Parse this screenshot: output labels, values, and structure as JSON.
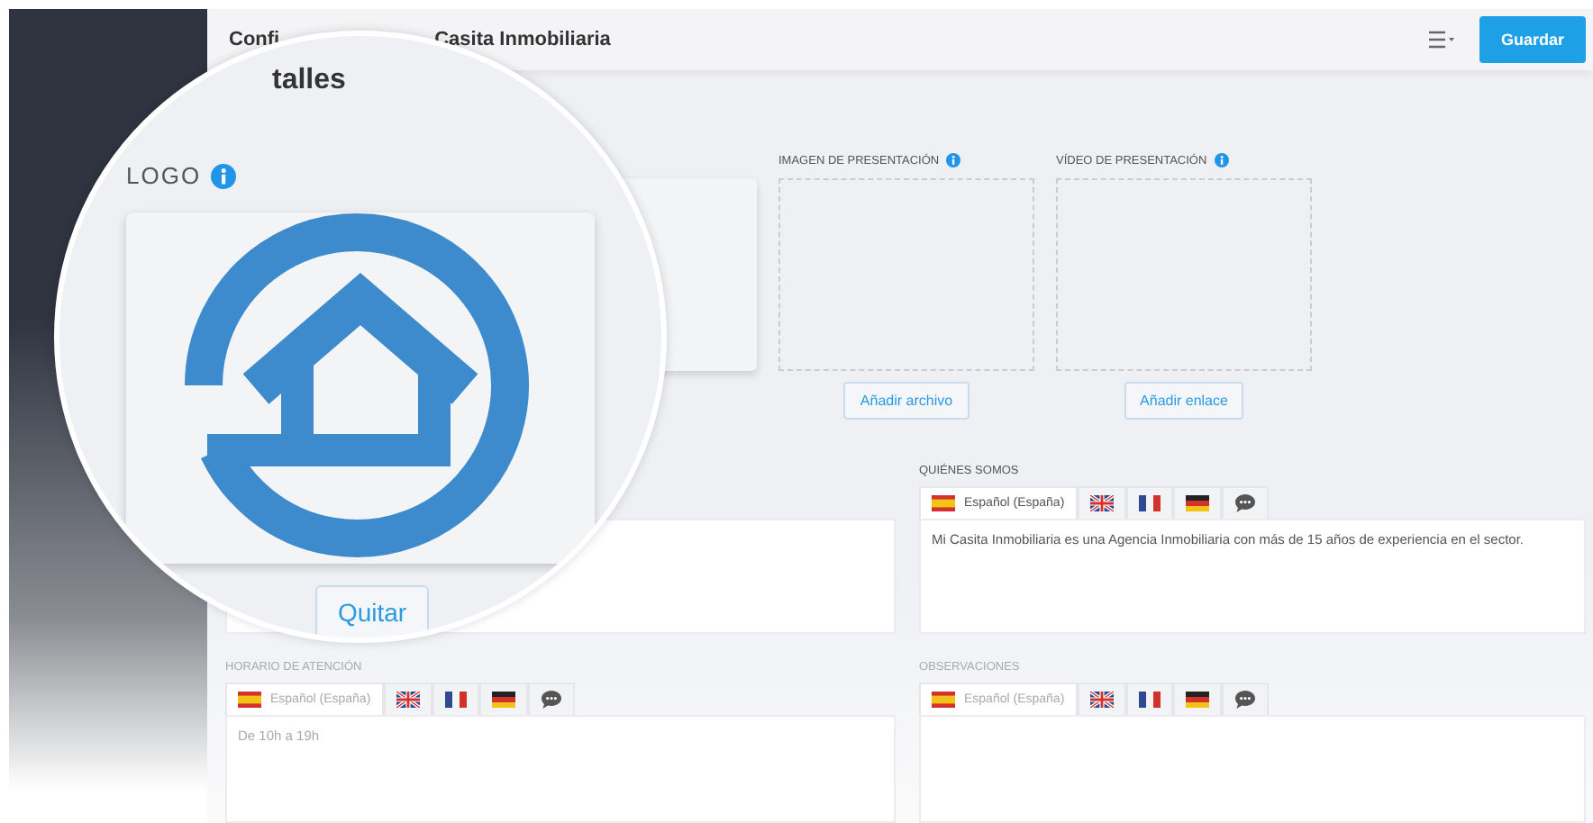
{
  "header": {
    "title_parts": [
      "Confi",
      "Casita Inmobiliaria"
    ],
    "save_button": "Guardar"
  },
  "media_columns": [
    {
      "label": "IMAGEN DE PRESENTACIÓN",
      "button": "Añadir archivo"
    },
    {
      "label": "VÍDEO DE PRESENTACIÓN",
      "button": "Añadir enlace"
    }
  ],
  "text_sections": [
    {
      "kind": "hidden"
    },
    {
      "kind": "full",
      "label": "QUIÉNES SOMOS",
      "text": "Mi Casita Inmobiliaria es una Agencia Inmobiliaria con más de 15 años de experiencia en el sector.",
      "tabs": [
        {
          "kind": "es",
          "label": "Español (España)",
          "selected": true
        },
        {
          "kind": "gb",
          "selected": false
        },
        {
          "kind": "fr",
          "selected": false
        },
        {
          "kind": "de",
          "selected": false
        },
        {
          "kind": "comment",
          "selected": false
        }
      ]
    },
    {
      "kind": "full",
      "label": "HORARIO DE ATENCIÓN",
      "text": "De 10h a 19h",
      "tabs": [
        {
          "kind": "es",
          "label": "Español (España)",
          "selected": true
        },
        {
          "kind": "gb",
          "selected": false
        },
        {
          "kind": "fr",
          "selected": false
        },
        {
          "kind": "de",
          "selected": false
        },
        {
          "kind": "comment",
          "selected": false
        }
      ]
    },
    {
      "kind": "full",
      "label": "OBSERVACIONES",
      "tabs": [
        {
          "kind": "es",
          "label": "Español (España)",
          "selected": true
        },
        {
          "kind": "gb",
          "selected": false
        },
        {
          "kind": "fr",
          "selected": false
        },
        {
          "kind": "de",
          "selected": false
        },
        {
          "kind": "comment",
          "selected": false
        }
      ]
    }
  ],
  "magnifier": {
    "heading": "talles",
    "label": "LOGO",
    "button": "Quitar"
  }
}
